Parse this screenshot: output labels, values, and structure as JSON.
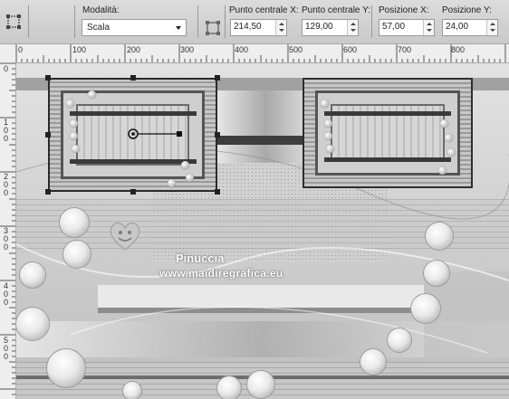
{
  "toolbar": {
    "mode_label": "Modalità:",
    "mode_value": "Scala",
    "center_x_label": "Punto centrale X:",
    "center_x_value": "214,50",
    "center_y_label": "Punto centrale Y:",
    "center_y_value": "129,00",
    "pos_x_label": "Posizione X:",
    "pos_x_value": "57,00",
    "pos_y_label": "Posizione Y:",
    "pos_y_value": "24,00"
  },
  "ruler": {
    "top_labels": [
      "0",
      "100",
      "200",
      "300",
      "400",
      "500",
      "600",
      "700",
      "800"
    ],
    "left_labels": [
      "0",
      "1 0 0",
      "2 0 0",
      "3 0 0",
      "4 0 0",
      "5 0 0"
    ]
  },
  "watermark": {
    "name": "Pinuccia",
    "url": "www.maidiregrafica.eu"
  },
  "icons": [
    "pick-tool-icon",
    "position-center-icon",
    "chevron-down-icon",
    "spin-up-icon",
    "spin-down-icon",
    "heart-logo-icon"
  ],
  "colors": {
    "canvas": "#d9d9d9",
    "toolbar": "#cfcfcf",
    "selection": "#222222"
  }
}
